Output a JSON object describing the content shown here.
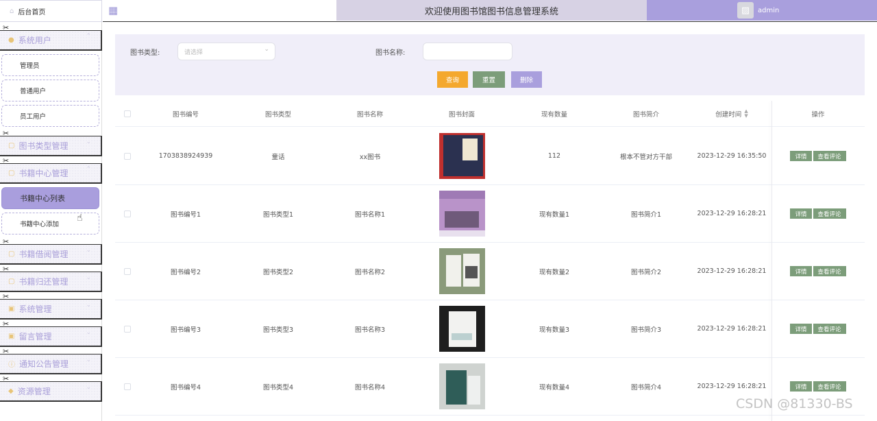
{
  "app": {
    "title": "欢迎使用图书馆图书信息管理系统",
    "user": "admin"
  },
  "sidebar": {
    "home": "后台首页",
    "groups": {
      "system_users": "系统用户",
      "book_types": "图书类型管理",
      "book_center": "书籍中心管理",
      "borrow": "书籍借阅管理",
      "return": "书籍归还管理",
      "system": "系统管理",
      "messages": "留言管理",
      "notices": "通知公告管理",
      "resources": "资源管理"
    },
    "subs": {
      "admin": "管理员",
      "normal_user": "普通用户",
      "staff_user": "员工用户",
      "book_list": "书籍中心列表",
      "book_add": "书籍中心添加"
    }
  },
  "filter": {
    "type_label": "图书类型:",
    "type_placeholder": "请选择",
    "name_label": "图书名称:",
    "search": "查询",
    "reset": "重置",
    "delete": "删除"
  },
  "table": {
    "headers": {
      "book_no": "图书编号",
      "book_type": "图书类型",
      "book_name": "图书名称",
      "cover": "图书封面",
      "qty": "现有数量",
      "intro": "图书简介",
      "created": "创建时间",
      "ops": "操作"
    },
    "rows": [
      {
        "no": "1703838924939",
        "type": "童话",
        "name": "xx图书",
        "qty": "112",
        "intro": "根本不管对方干部",
        "created": "2023-12-29 16:35:50",
        "detail": "详情",
        "review": "查看评论"
      },
      {
        "no": "图书编号1",
        "type": "图书类型1",
        "name": "图书名称1",
        "qty": "现有数量1",
        "intro": "图书简介1",
        "created": "2023-12-29 16:28:21",
        "detail": "详情",
        "review": "查看评论"
      },
      {
        "no": "图书编号2",
        "type": "图书类型2",
        "name": "图书名称2",
        "qty": "现有数量2",
        "intro": "图书简介2",
        "created": "2023-12-29 16:28:21",
        "detail": "详情",
        "review": "查看评论"
      },
      {
        "no": "图书编号3",
        "type": "图书类型3",
        "name": "图书名称3",
        "qty": "现有数量3",
        "intro": "图书简介3",
        "created": "2023-12-29 16:28:21",
        "detail": "详情",
        "review": "查看评论"
      },
      {
        "no": "图书编号4",
        "type": "图书类型4",
        "name": "图书名称4",
        "qty": "现有数量4",
        "intro": "图书简介4",
        "created": "2023-12-29 16:28:21",
        "detail": "详情",
        "review": "查看评论"
      }
    ]
  },
  "watermark": "CSDN @81330-BS",
  "colors": {
    "accent": "#a99fdd",
    "green": "#7c9d7a",
    "orange": "#f4a82e",
    "header_title_bg": "#d7d2e4",
    "filter_bg": "#f0eef9"
  }
}
